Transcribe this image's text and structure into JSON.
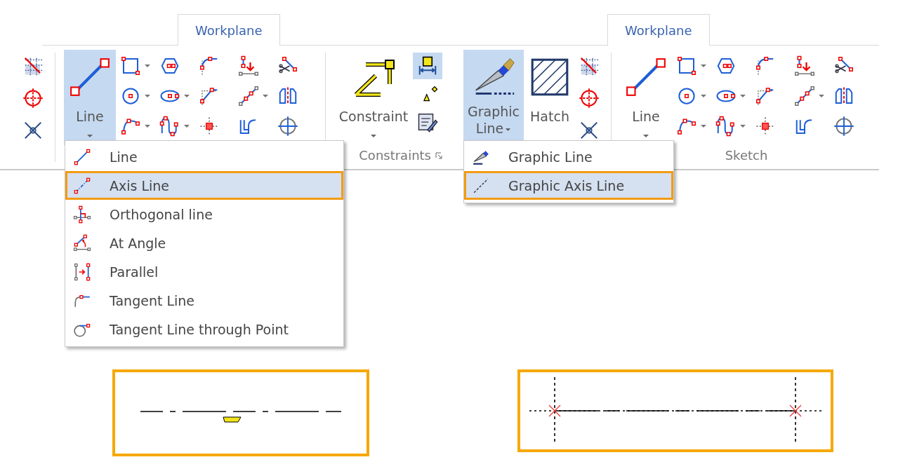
{
  "left_ribbon": {
    "tab": {
      "label": "Workplane",
      "selected": true
    },
    "line_button": {
      "label": "Line",
      "selected": true
    },
    "constraint_button": {
      "label": "Constraint",
      "selected": false
    },
    "dimension_button": {
      "selected": true
    },
    "group_label": "Constraints",
    "menu": [
      {
        "label": "Line",
        "selected": false
      },
      {
        "label": "Axis Line",
        "selected": true
      },
      {
        "label": "Orthogonal line",
        "selected": false
      },
      {
        "label": "At Angle",
        "selected": false
      },
      {
        "label": "Parallel",
        "selected": false
      },
      {
        "label": "Tangent Line",
        "selected": false
      },
      {
        "label": "Tangent Line through Point",
        "selected": false
      }
    ]
  },
  "right_ribbon": {
    "tab": {
      "label": "Workplane",
      "selected": true
    },
    "graphic_line_button": {
      "label": "Graphic Line",
      "selected": true
    },
    "hatch_button": {
      "label": "Hatch",
      "selected": false
    },
    "line_button": {
      "label": "Line",
      "selected": false
    },
    "group_label": "Sketch",
    "menu": [
      {
        "label": "Graphic Line",
        "selected": false
      },
      {
        "label": "Graphic Axis Line",
        "selected": true
      }
    ]
  }
}
